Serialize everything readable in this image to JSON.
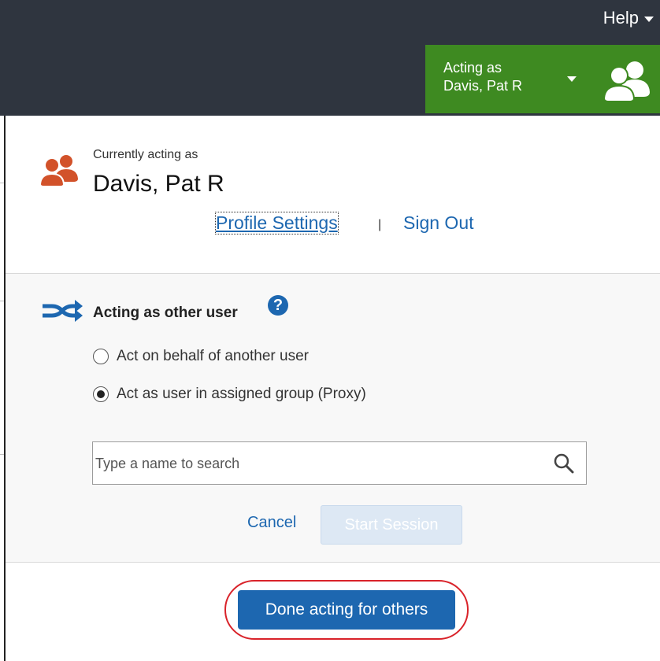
{
  "header": {
    "help_label": "Help",
    "acting_line1": "Acting as",
    "acting_line2": "Davis, Pat R",
    "bar_color": "#2f353f",
    "acting_color": "#3e8a21"
  },
  "current": {
    "label": "Currently acting as",
    "name": "Davis, Pat R",
    "profile_link": "Profile Settings",
    "separator": "|",
    "signout_link": "Sign Out",
    "icon": "users-icon"
  },
  "other_user": {
    "title": "Acting as other user",
    "help_glyph": "?",
    "options": [
      {
        "label": "Act on behalf of another user",
        "selected": false
      },
      {
        "label": "Act as user in assigned group (Proxy)",
        "selected": true
      }
    ],
    "search_placeholder": "Type a name to search",
    "cancel_label": "Cancel",
    "start_label": "Start Session",
    "icon": "shuffle-icon"
  },
  "footer": {
    "done_label": "Done acting for others",
    "button_color": "#1d67b0",
    "highlight_color": "#d9232a"
  }
}
